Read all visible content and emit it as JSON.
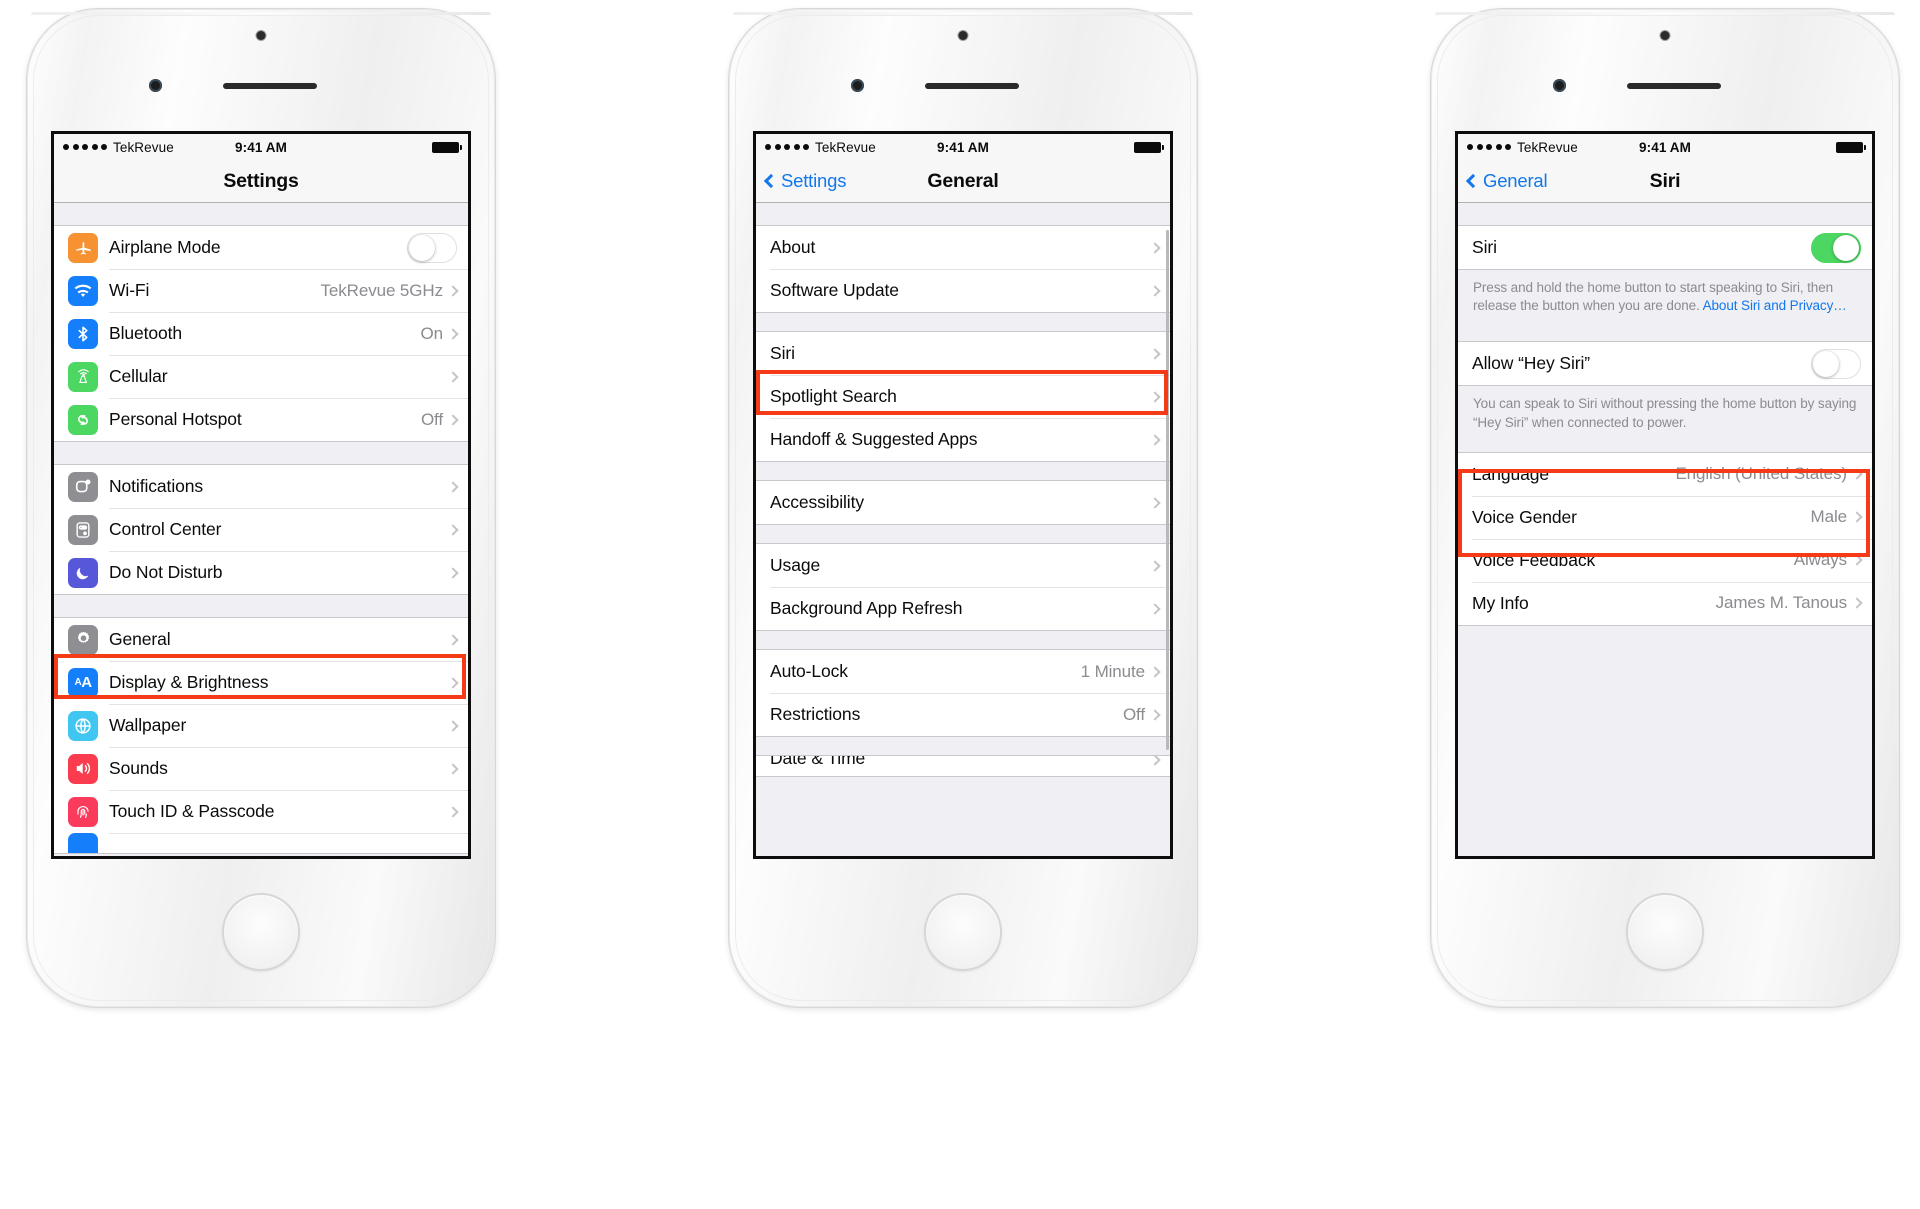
{
  "meta": {
    "accent_blue": "#1277ec",
    "highlight_red": "#f43a17",
    "toggle_green": "#4cd662"
  },
  "status_bar": {
    "carrier": "TekRevue",
    "time": "9:41 AM",
    "signal_dots": 5
  },
  "phones": [
    {
      "id": "phone-settings",
      "nav": {
        "title": "Settings",
        "back_label": ""
      },
      "groups": [
        {
          "rows": [
            {
              "label": "Airplane Mode",
              "value": "",
              "accessory": "toggle-off",
              "icon": "airplane-icon",
              "icon_color": "#f79232",
              "highlight": false
            },
            {
              "label": "Wi-Fi",
              "value": "TekRevue 5GHz",
              "accessory": "chevron",
              "icon": "wifi-icon",
              "icon_color": "#147efb",
              "highlight": false
            },
            {
              "label": "Bluetooth",
              "value": "On",
              "accessory": "chevron",
              "icon": "bluetooth-icon",
              "icon_color": "#147efb",
              "highlight": false
            },
            {
              "label": "Cellular",
              "value": "",
              "accessory": "chevron",
              "icon": "cellular-icon",
              "icon_color": "#4cd662",
              "highlight": false
            },
            {
              "label": "Personal Hotspot",
              "value": "Off",
              "accessory": "chevron",
              "icon": "hotspot-icon",
              "icon_color": "#4cd662",
              "highlight": false
            }
          ]
        },
        {
          "rows": [
            {
              "label": "Notifications",
              "value": "",
              "accessory": "chevron",
              "icon": "notifications-icon",
              "icon_color": "#8e8e93",
              "highlight": false
            },
            {
              "label": "Control Center",
              "value": "",
              "accessory": "chevron",
              "icon": "control-center-icon",
              "icon_color": "#8e8e93",
              "highlight": false
            },
            {
              "label": "Do Not Disturb",
              "value": "",
              "accessory": "chevron",
              "icon": "moon-icon",
              "icon_color": "#5757d9",
              "highlight": false
            }
          ]
        },
        {
          "rows": [
            {
              "label": "General",
              "value": "",
              "accessory": "chevron",
              "icon": "gear-icon",
              "icon_color": "#8e8e93",
              "highlight": true
            },
            {
              "label": "Display & Brightness",
              "value": "",
              "accessory": "chevron",
              "icon": "display-brightness-icon",
              "icon_color": "#147efb",
              "highlight": false
            },
            {
              "label": "Wallpaper",
              "value": "",
              "accessory": "chevron",
              "icon": "wallpaper-icon",
              "icon_color": "#3fc7f2",
              "highlight": false
            },
            {
              "label": "Sounds",
              "value": "",
              "accessory": "chevron",
              "icon": "sounds-icon",
              "icon_color": "#fb3b4e",
              "highlight": false
            },
            {
              "label": "Touch ID & Passcode",
              "value": "",
              "accessory": "chevron",
              "icon": "touch-id-icon",
              "icon_color": "#fb3b5c",
              "highlight": false
            },
            {
              "label": "",
              "value": "",
              "accessory": "chevron",
              "icon": "privacy-icon",
              "icon_color": "#147efb",
              "highlight": false
            }
          ]
        }
      ]
    },
    {
      "id": "phone-general",
      "nav": {
        "title": "General",
        "back_label": "Settings"
      },
      "groups": [
        {
          "rows": [
            {
              "label": "About",
              "value": "",
              "accessory": "chevron",
              "highlight": false
            },
            {
              "label": "Software Update",
              "value": "",
              "accessory": "chevron",
              "highlight": false
            }
          ]
        },
        {
          "rows": [
            {
              "label": "Siri",
              "value": "",
              "accessory": "chevron",
              "highlight": true
            },
            {
              "label": "Spotlight Search",
              "value": "",
              "accessory": "chevron",
              "highlight": false
            },
            {
              "label": "Handoff & Suggested Apps",
              "value": "",
              "accessory": "chevron",
              "highlight": false
            }
          ]
        },
        {
          "rows": [
            {
              "label": "Accessibility",
              "value": "",
              "accessory": "chevron",
              "highlight": false
            }
          ]
        },
        {
          "rows": [
            {
              "label": "Usage",
              "value": "",
              "accessory": "chevron",
              "highlight": false
            },
            {
              "label": "Background App Refresh",
              "value": "",
              "accessory": "chevron",
              "highlight": false
            }
          ]
        },
        {
          "rows": [
            {
              "label": "Auto-Lock",
              "value": "1 Minute",
              "accessory": "chevron",
              "highlight": false
            },
            {
              "label": "Restrictions",
              "value": "Off",
              "accessory": "chevron",
              "highlight": false
            }
          ]
        },
        {
          "rows": [
            {
              "label": "Date & Time",
              "value": "",
              "accessory": "chevron",
              "highlight": false
            }
          ]
        }
      ]
    },
    {
      "id": "phone-siri",
      "nav": {
        "title": "Siri",
        "back_label": "General"
      },
      "groups": [
        {
          "rows": [
            {
              "label": "Siri",
              "value": "",
              "accessory": "toggle-on",
              "highlight": false
            }
          ],
          "note": "Press and hold the home button to start speaking to Siri, then release the button when you are done. ",
          "note_link": "About Siri and Privacy…"
        },
        {
          "rows": [
            {
              "label": "Allow “Hey Siri”",
              "value": "",
              "accessory": "toggle-off",
              "highlight": false
            }
          ],
          "note": "You can speak to Siri without pressing the home button by saying “Hey Siri” when connected to power.",
          "note_link": ""
        },
        {
          "rows": [
            {
              "label": "Language",
              "value": "English (United States)",
              "accessory": "chevron",
              "highlight": true
            },
            {
              "label": "Voice Gender",
              "value": "Male",
              "accessory": "chevron",
              "highlight": true
            },
            {
              "label": "Voice Feedback",
              "value": "Always",
              "accessory": "chevron",
              "highlight": false
            },
            {
              "label": "My Info",
              "value": "James M. Tanous",
              "accessory": "chevron",
              "highlight": false
            }
          ]
        }
      ]
    }
  ]
}
